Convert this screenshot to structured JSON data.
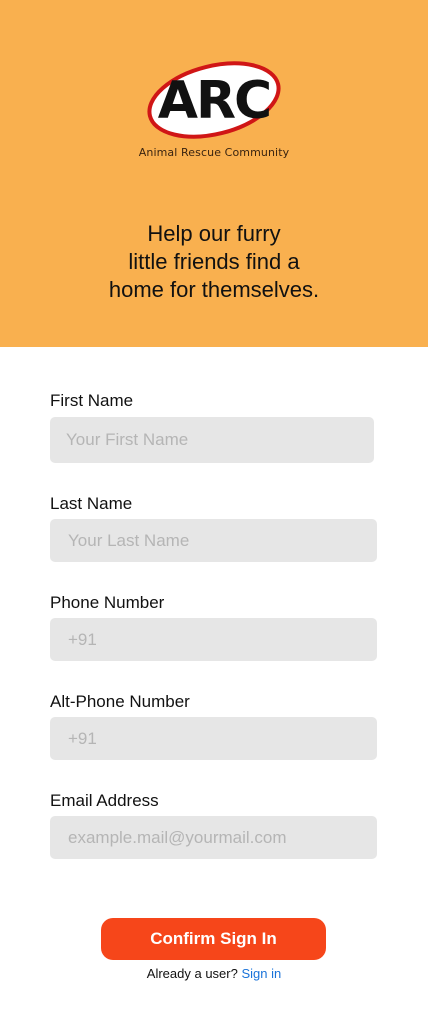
{
  "header": {
    "logo_text": "ARC",
    "logo_tagline": "Animal Rescue Community",
    "tagline_lines": [
      "Help our furry",
      "little friends find a",
      "home for themselves."
    ],
    "background_color": "#f9b04f"
  },
  "form": {
    "first_name": {
      "label": "First Name",
      "placeholder": "Your First Name",
      "value": ""
    },
    "last_name": {
      "label": "Last Name",
      "placeholder": "Your Last Name",
      "value": ""
    },
    "phone": {
      "label": "Phone Number",
      "placeholder": "+91",
      "value": ""
    },
    "alt_phone": {
      "label": "Alt-Phone Number",
      "placeholder": "+91",
      "value": ""
    },
    "email": {
      "label": "Email Address",
      "placeholder": "example.mail@yourmail.com",
      "value": ""
    }
  },
  "actions": {
    "confirm_label": "Confirm Sign In",
    "already_user_text": "Already a user?",
    "sign_in_link": "Sign in",
    "accent_color": "#f6461a",
    "link_color": "#1a73d9"
  }
}
